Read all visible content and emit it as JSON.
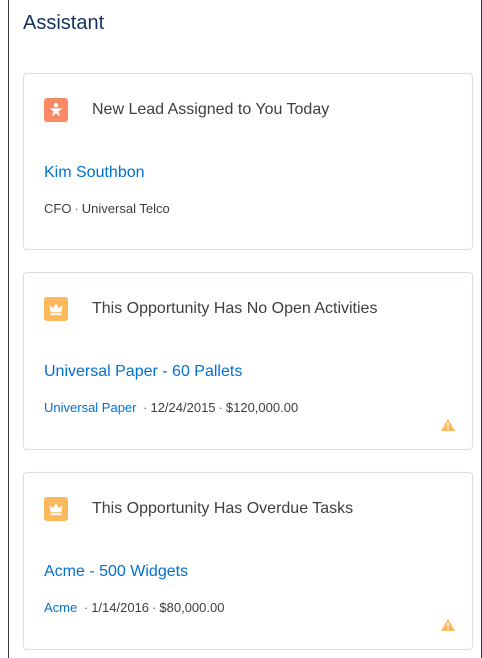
{
  "panel": {
    "title": "Assistant"
  },
  "cards": [
    {
      "heading": "New Lead Assigned to You Today",
      "icon": "lead-icon",
      "icon_color": "#f88962",
      "record": "Kim Southbon",
      "meta_title": "CFO",
      "meta_company": "Universal Telco"
    },
    {
      "heading": "This Opportunity Has No Open Activities",
      "icon": "opportunity-crown-icon",
      "icon_color": "#fcb95b",
      "record": "Universal Paper - 60 Pallets",
      "meta_account": "Universal Paper",
      "meta_date": "12/24/2015",
      "meta_amount": "$120,000.00",
      "warning": "warning-icon"
    },
    {
      "heading": "This Opportunity Has Overdue Tasks",
      "icon": "opportunity-crown-icon",
      "icon_color": "#fcb95b",
      "record": "Acme - 500 Widgets",
      "meta_account": "Acme",
      "meta_date": "1/14/2016",
      "meta_amount": "$80,000.00",
      "warning": "warning-icon"
    }
  ],
  "colors": {
    "link": "#0070d2",
    "warning": "#ffb75d",
    "card_border": "#d8dde6"
  },
  "separator": "·"
}
